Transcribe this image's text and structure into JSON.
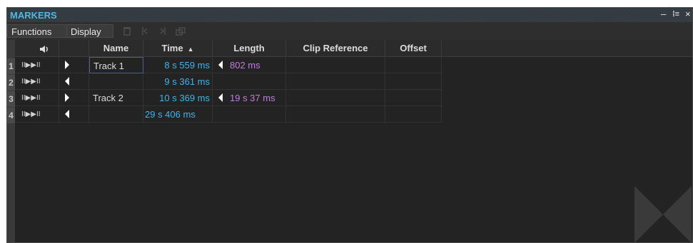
{
  "panel": {
    "title": "MARKERS"
  },
  "window_controls": {
    "minimize": "–",
    "dock": "⁞≡",
    "close": "×"
  },
  "toolbar": {
    "functions_label": "Functions",
    "display_label": "Display"
  },
  "columns": {
    "name": "Name",
    "time": "Time",
    "time_sort": "▲",
    "length": "Length",
    "clip_reference": "Clip Reference",
    "offset": "Offset"
  },
  "rows": [
    {
      "num": "1",
      "transport": "II▶▶II",
      "direction": "start",
      "name": "Track 1",
      "time": "8 s 559 ms",
      "length": "802 ms"
    },
    {
      "num": "2",
      "transport": "II▶▶II",
      "direction": "end",
      "name": "",
      "time": "9 s 361 ms",
      "length": ""
    },
    {
      "num": "3",
      "transport": "II▶▶II",
      "direction": "start",
      "name": "Track 2",
      "time": "10 s 369 ms",
      "length": "19 s 37 ms"
    },
    {
      "num": "4",
      "transport": "II▶▶II",
      "direction": "end",
      "name": "",
      "time": "29 s 406 ms",
      "length": ""
    }
  ],
  "colors": {
    "accent_title": "#4fb8e6",
    "time_text": "#3fb4ea",
    "length_text": "#c27be0"
  }
}
